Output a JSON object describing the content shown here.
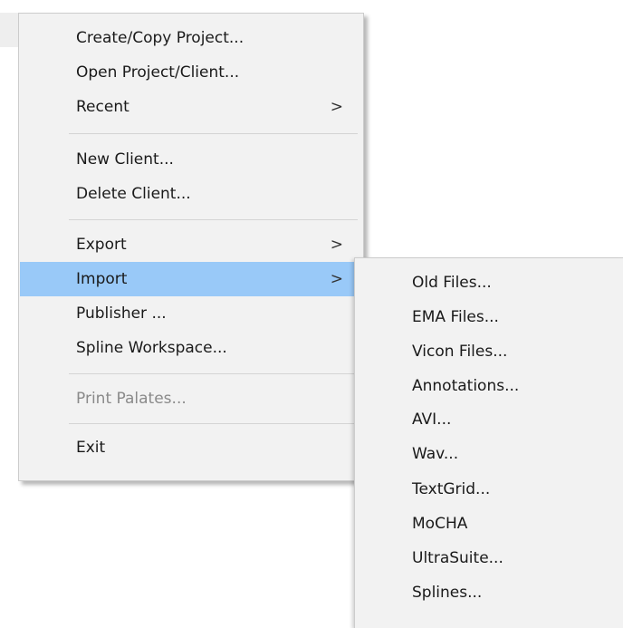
{
  "main_menu": {
    "items": [
      {
        "label": "Create/Copy Project..."
      },
      {
        "label": "Open Project/Client..."
      },
      {
        "label": "Recent",
        "arrow": ">"
      },
      {
        "label": "New Client..."
      },
      {
        "label": "Delete Client..."
      },
      {
        "label": "Export",
        "arrow": ">"
      },
      {
        "label": "Import",
        "arrow": ">"
      },
      {
        "label": "Publisher ..."
      },
      {
        "label": "Spline Workspace..."
      },
      {
        "label": "Print Palates..."
      },
      {
        "label": "Exit"
      }
    ]
  },
  "import_submenu": {
    "items": [
      {
        "label": "Old Files..."
      },
      {
        "label": "EMA Files..."
      },
      {
        "label": "Vicon Files..."
      },
      {
        "label": "Annotations..."
      },
      {
        "label": "AVI..."
      },
      {
        "label": "Wav..."
      },
      {
        "label": "TextGrid..."
      },
      {
        "label": "MoCHA"
      },
      {
        "label": "UltraSuite..."
      },
      {
        "label": "Splines..."
      }
    ]
  },
  "colors": {
    "menu_background": "#f2f2f2",
    "highlight": "#99c9f8",
    "disabled_text": "#8a8a8a"
  }
}
